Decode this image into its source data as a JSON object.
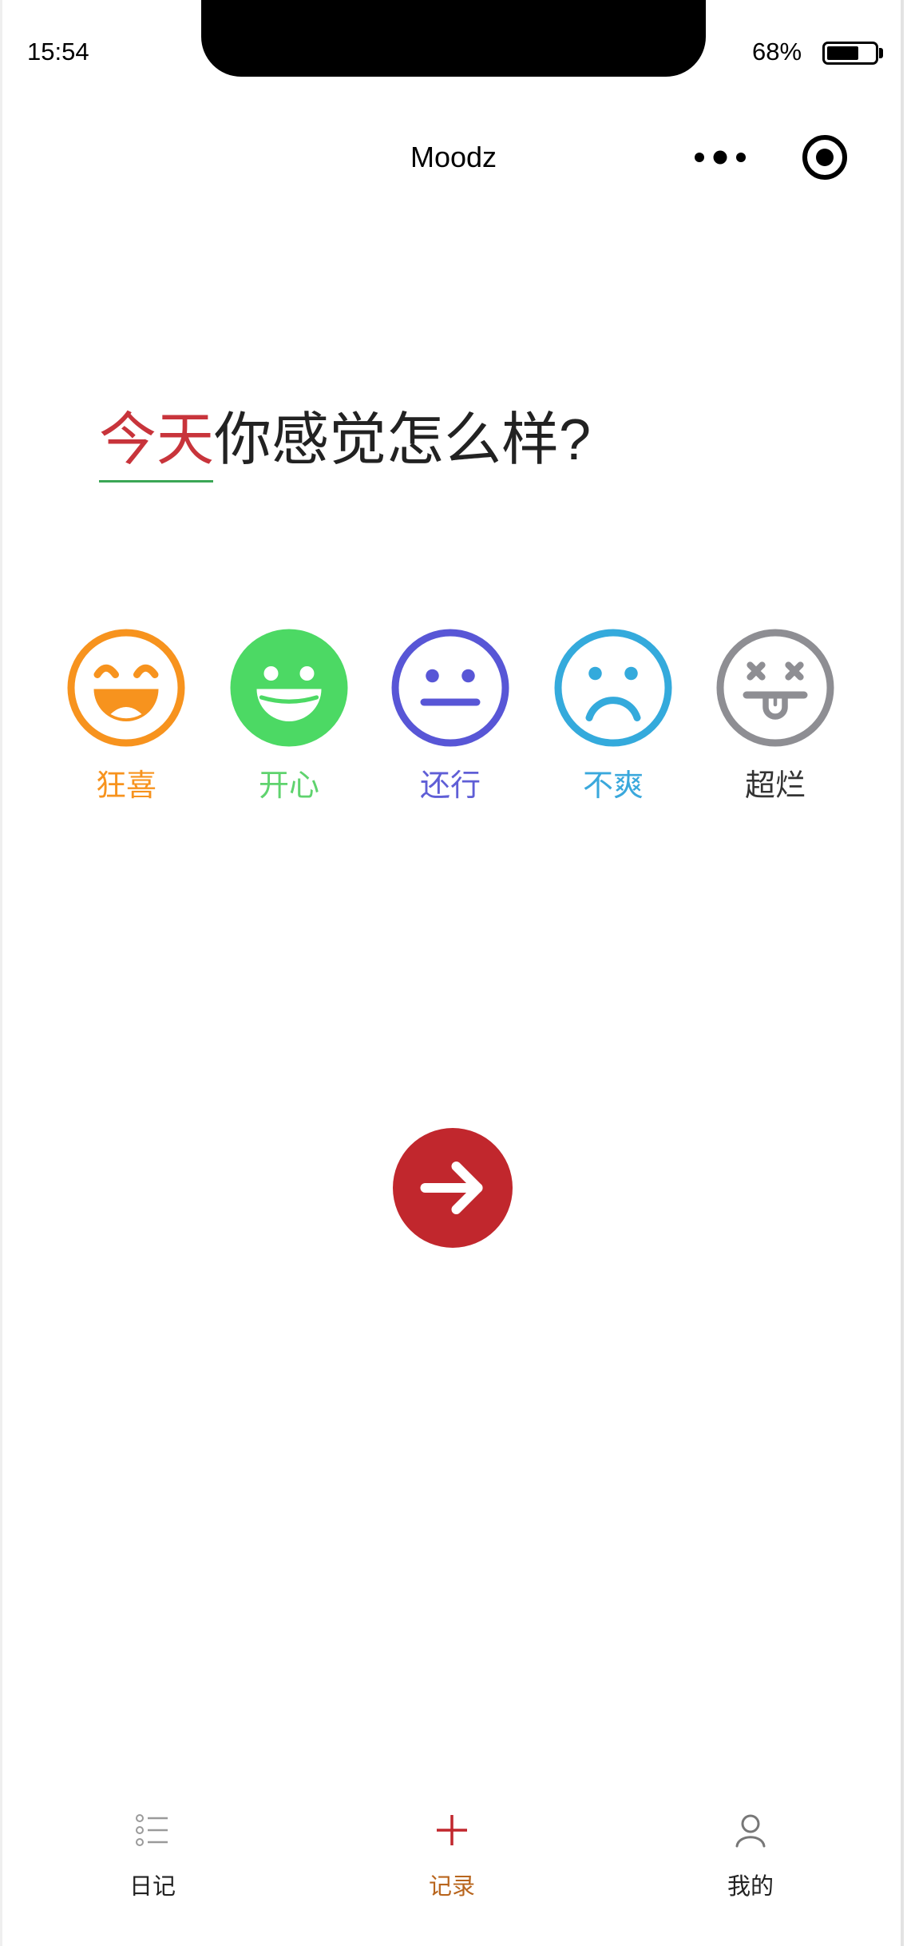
{
  "status_bar": {
    "time": "15:54",
    "battery_text": "68%",
    "battery_level": 0.68
  },
  "nav_bar": {
    "title": "Moodz",
    "more_icon": "more-dots-icon",
    "target_icon": "target-icon"
  },
  "prompt": {
    "highlight": "今天",
    "rest": "你感觉怎么样?",
    "highlight_color": "#c8343b",
    "underline_color": "#3aa655"
  },
  "moods": [
    {
      "label": "狂喜",
      "icon": "ecstatic-face-icon",
      "color": "#f7931e",
      "label_color": "#f7931e"
    },
    {
      "label": "开心",
      "icon": "happy-face-icon",
      "color": "#4cd964",
      "label_color": "#5fd36e"
    },
    {
      "label": "还行",
      "icon": "neutral-face-icon",
      "color": "#5856d6",
      "label_color": "#5f5ed6"
    },
    {
      "label": "不爽",
      "icon": "sad-face-icon",
      "color": "#34aadc",
      "label_color": "#3aa8dc"
    },
    {
      "label": "超烂",
      "icon": "dead-face-icon",
      "color": "#8e8e93",
      "label_color": "#333333"
    }
  ],
  "next_button": {
    "icon": "arrow-right-icon",
    "color": "#c1272d"
  },
  "tab_bar": {
    "active_color": "#b8651d",
    "items": [
      {
        "label": "日记",
        "icon": "list-icon",
        "active": false
      },
      {
        "label": "记录",
        "icon": "plus-icon",
        "active": true
      },
      {
        "label": "我的",
        "icon": "person-icon",
        "active": false
      }
    ]
  }
}
